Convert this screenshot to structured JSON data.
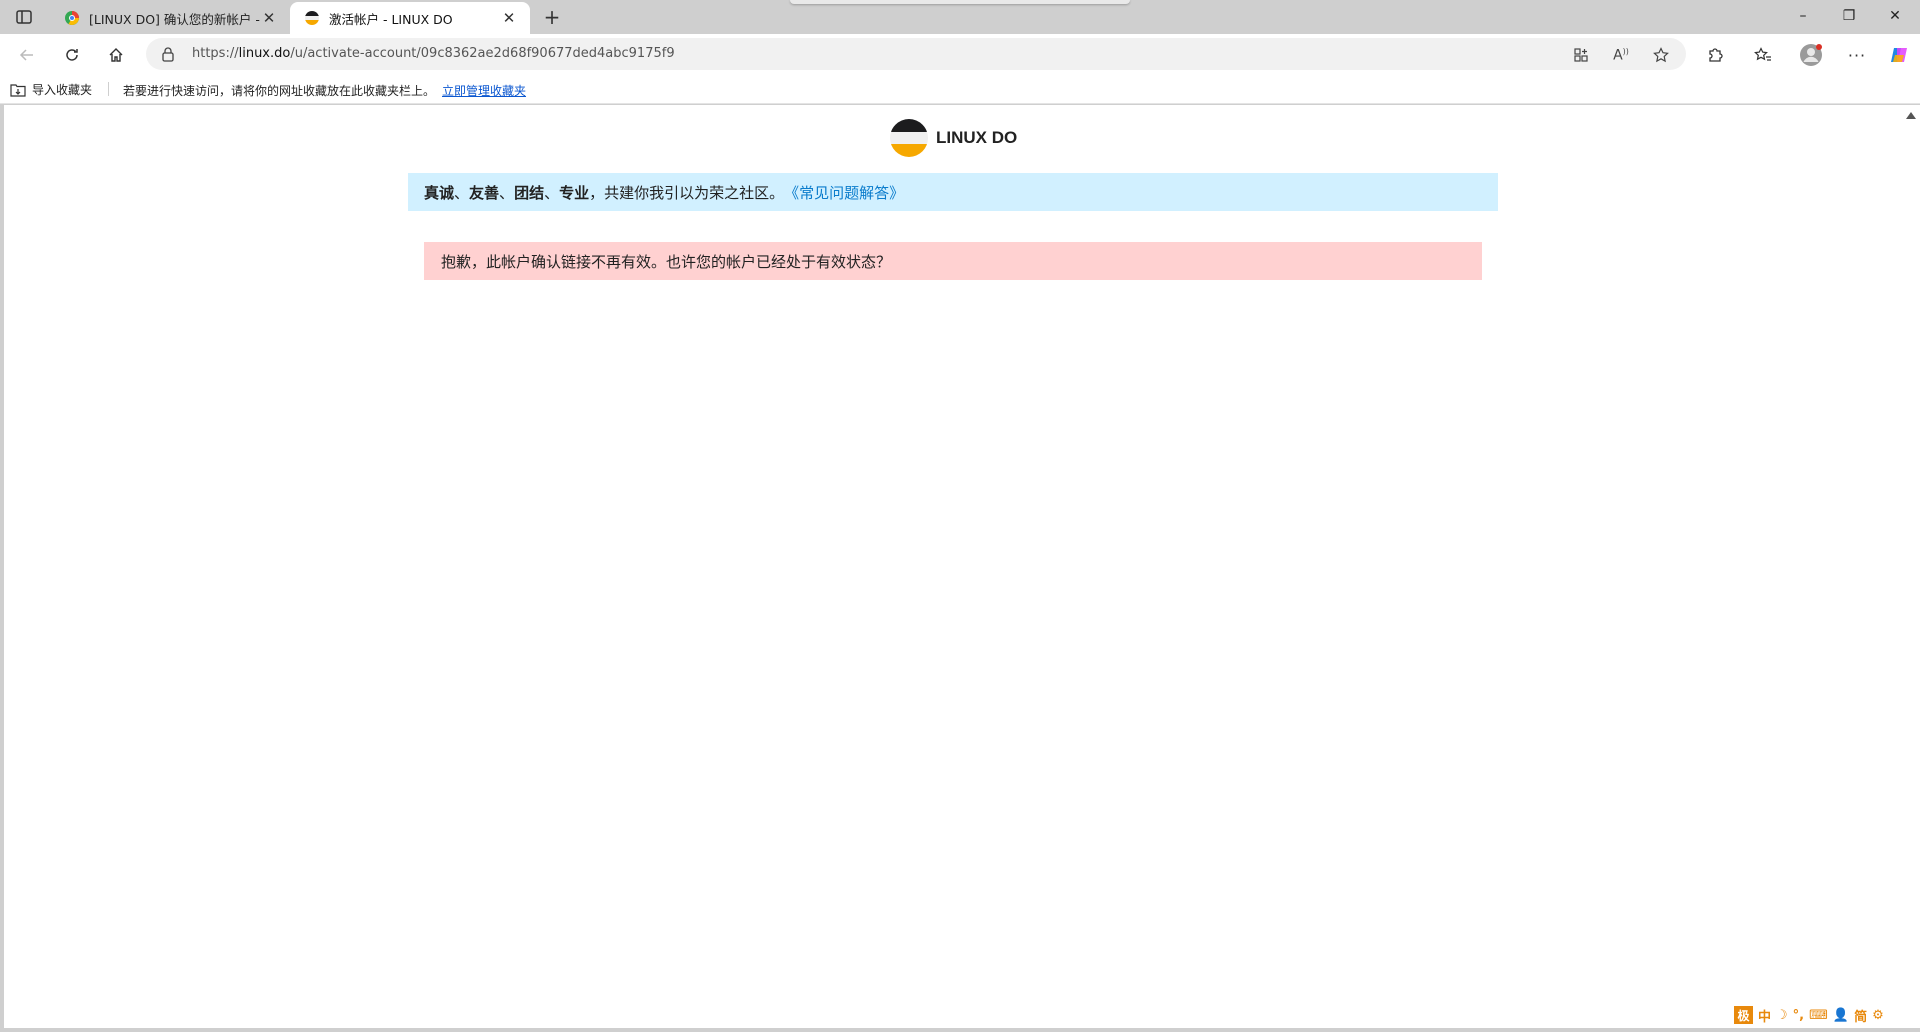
{
  "tabs": [
    {
      "title": "[LINUX DO] 确认您的新帐户 - QQ",
      "active": false,
      "favicon": "qq-mail-favicon"
    },
    {
      "title": "激活帐户 - LINUX DO",
      "active": true,
      "favicon": "linuxdo-favicon"
    }
  ],
  "window_controls": {
    "minimize": "–",
    "restore": "❐",
    "close": "✕"
  },
  "address": {
    "scheme": "https://",
    "host": "linux.do",
    "path": "/u/activate-account/09c8362ae2d68f90677ded4abc9175f9"
  },
  "bookmarks": {
    "import_label": "导入收藏夹",
    "hint": "若要进行快速访问，请将你的网址收藏放在此收藏夹栏上。",
    "manage_link": "立即管理收藏夹"
  },
  "page": {
    "brand": "LINUX DO",
    "banner": {
      "values": [
        "真诚",
        "友善",
        "团结",
        "专业"
      ],
      "sep": "、",
      "rest": "，共建你我引以为荣之社区。",
      "faq": "《常见问题解答》"
    },
    "alert": "抱歉，此帐户确认链接不再有效。也许您的帐户已经处于有效状态？"
  },
  "ime": {
    "logo": "极",
    "mode": "中",
    "simplified": "简"
  },
  "colors": {
    "banner_bg": "#d1f0ff",
    "alert_bg": "#ffd1d1",
    "link": "#0a7ccc",
    "ime_orange": "#e8890c"
  }
}
